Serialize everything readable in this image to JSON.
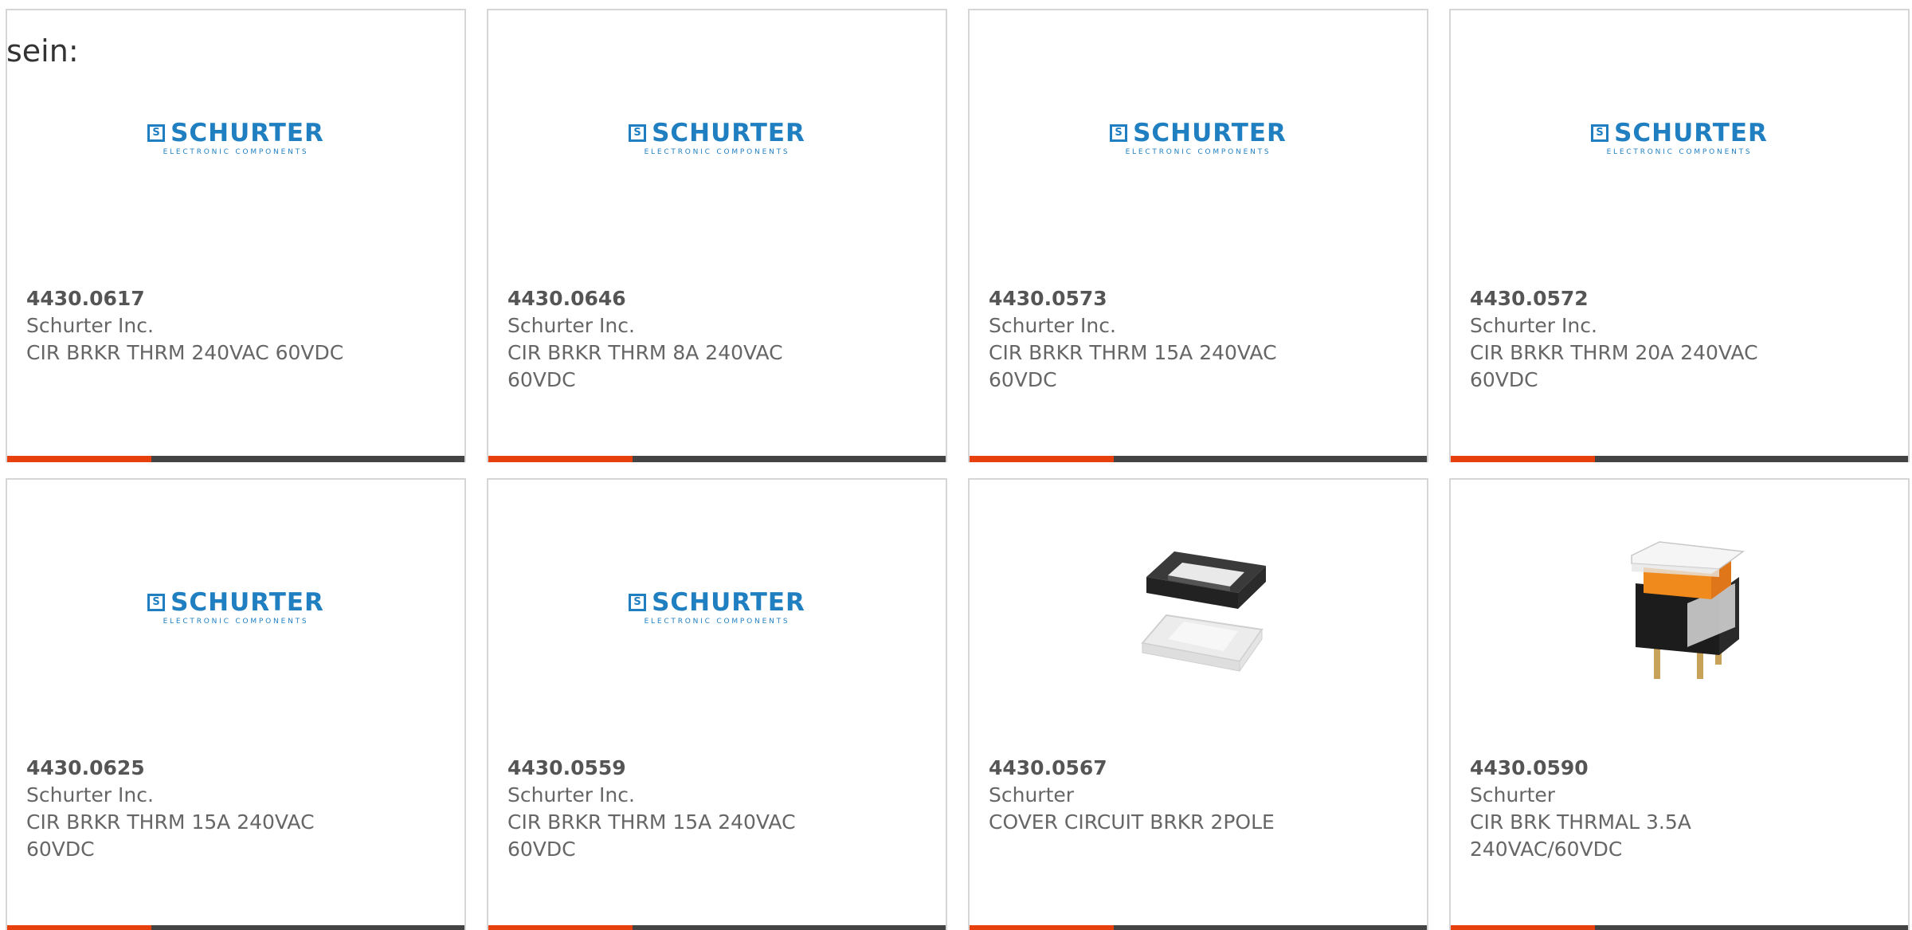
{
  "intro_text": "sein:",
  "brand": {
    "mark": "S",
    "name": "SCHURTER",
    "tagline": "ELECTRONIC COMPONENTS",
    "color": "#1f7fc1"
  },
  "colors": {
    "accent": "#e8400c",
    "bar": "#444444",
    "border": "#d6d6d6"
  },
  "products": [
    {
      "part_number": "4430.0617",
      "manufacturer": "Schurter Inc.",
      "description": "CIR BRKR THRM 240VAC 60VDC",
      "image": "schurter-logo"
    },
    {
      "part_number": "4430.0646",
      "manufacturer": "Schurter Inc.",
      "description": "CIR BRKR THRM 8A 240VAC 60VDC",
      "image": "schurter-logo"
    },
    {
      "part_number": "4430.0573",
      "manufacturer": "Schurter Inc.",
      "description": "CIR BRKR THRM 15A 240VAC 60VDC",
      "image": "schurter-logo"
    },
    {
      "part_number": "4430.0572",
      "manufacturer": "Schurter Inc.",
      "description": "CIR BRKR THRM 20A 240VAC 60VDC",
      "image": "schurter-logo"
    },
    {
      "part_number": "4430.0625",
      "manufacturer": "Schurter Inc.",
      "description": "CIR BRKR THRM 15A 240VAC 60VDC",
      "image": "schurter-logo"
    },
    {
      "part_number": "4430.0559",
      "manufacturer": "Schurter Inc.",
      "description": "CIR BRKR THRM 15A 240VAC 60VDC",
      "image": "schurter-logo"
    },
    {
      "part_number": "4430.0567",
      "manufacturer": "Schurter",
      "description": "COVER CIRCUIT BRKR 2POLE",
      "image": "breaker-cover-photo"
    },
    {
      "part_number": "4430.0590",
      "manufacturer": "Schurter",
      "description": "CIR BRK THRMAL 3.5A 240VAC/60VDC",
      "image": "breaker-switch-photo"
    }
  ]
}
